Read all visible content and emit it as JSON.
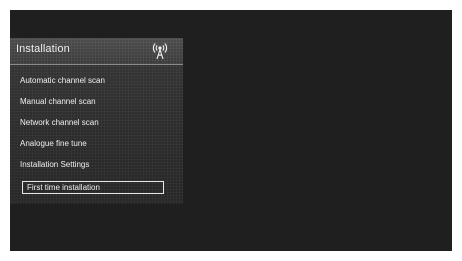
{
  "menu": {
    "title": "Installation",
    "header_icon": "antenna-icon",
    "items": [
      {
        "label": "Automatic channel scan",
        "selected": false
      },
      {
        "label": "Manual channel scan",
        "selected": false
      },
      {
        "label": "Network channel scan",
        "selected": false
      },
      {
        "label": "Analogue fine tune",
        "selected": false
      },
      {
        "label": "Installation Settings",
        "selected": false
      },
      {
        "label": "First time installation",
        "selected": true
      }
    ]
  },
  "colors": {
    "screen_background": "#1f1f1f",
    "panel_background": "#2c2c2c",
    "text": "#f0f0f0",
    "selection_border": "#e6e6e6"
  }
}
